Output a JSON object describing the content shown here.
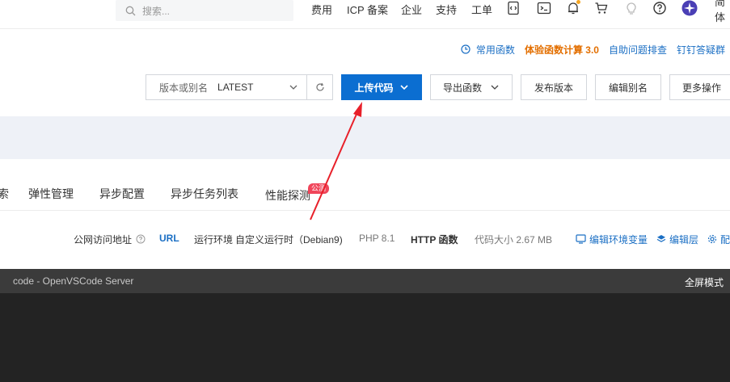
{
  "topbar": {
    "search_placeholder": "搜索...",
    "nav": [
      "费用",
      "ICP 备案",
      "企业",
      "支持",
      "工单"
    ],
    "icons": [
      "code-icon",
      "terminal-icon",
      "bell-icon",
      "cart-icon",
      "bulb-icon",
      "help-icon",
      "avatar"
    ],
    "language": "简体"
  },
  "help_links": {
    "faq": "常用函数",
    "trial": "体验函数计算 3.0",
    "self_check": "自助问题排查",
    "dingtalk": "钉钉答疑群"
  },
  "toolbar": {
    "version_label": "版本或别名",
    "version_value": "LATEST",
    "upload": "上传代码",
    "export": "导出函数",
    "publish": "发布版本",
    "edit_alias": "编辑别名",
    "more": "更多操作"
  },
  "tabs": {
    "partial": "索",
    "items": [
      "弹性管理",
      "异步配置",
      "异步任务列表",
      "性能探测"
    ],
    "badge": "公测"
  },
  "info": {
    "public_url_label": "公网访问地址",
    "url_link": "URL",
    "runtime_label": "运行环境",
    "runtime_value": "自定义运行时（Debian9)",
    "php": "PHP 8.1",
    "http": "HTTP 函数",
    "code_size": "代码大小 2.67 MB",
    "edit_env": "编辑环境变量",
    "edit_layer": "编辑层",
    "config_partial": "配"
  },
  "editor": {
    "title": "code - OpenVSCode Server",
    "fullscreen": "全屏模式"
  },
  "colors": {
    "primary": "#0b6ed1",
    "link": "#1b6fc4",
    "orange": "#e36f00",
    "badge": "#f0455a",
    "annotation_arrow": "#e8202a"
  }
}
